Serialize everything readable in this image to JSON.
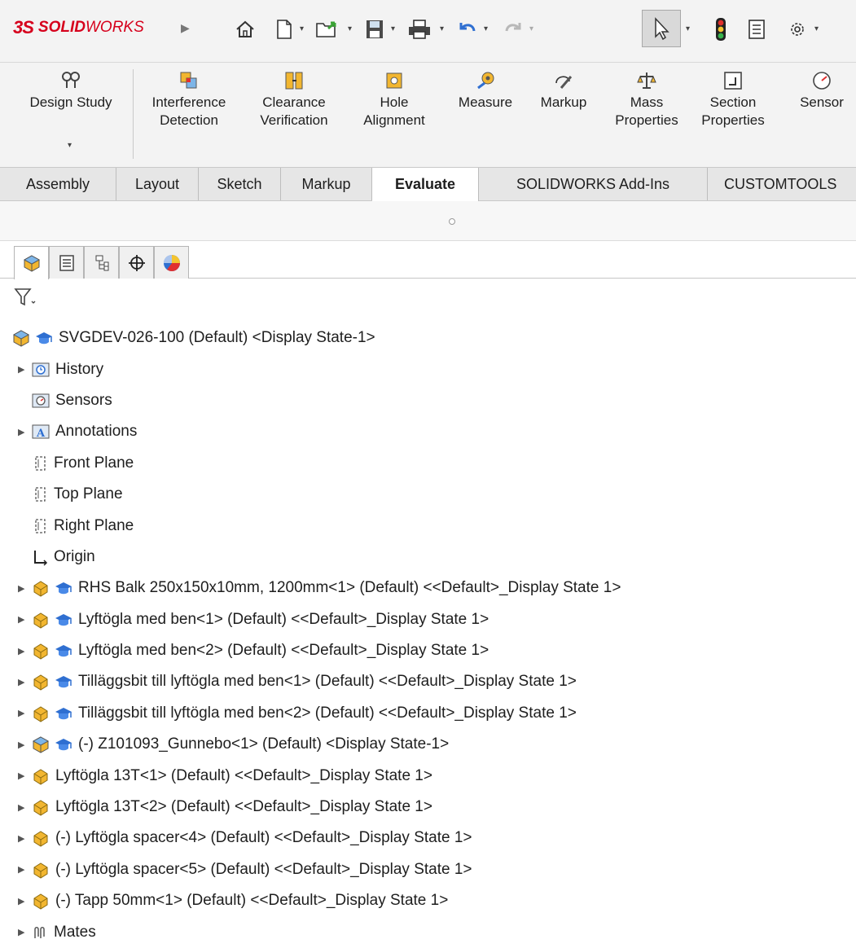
{
  "app": {
    "logo_ds": "3S",
    "logo_solid": "SOLID",
    "logo_works": "WORKS"
  },
  "command_manager": {
    "design_study": "Design Study",
    "interference_1": "Interference",
    "interference_2": "Detection",
    "clearance_1": "Clearance",
    "clearance_2": "Verification",
    "hole_1": "Hole",
    "hole_2": "Alignment",
    "measure": "Measure",
    "markup": "Markup",
    "mass_1": "Mass",
    "mass_2": "Properties",
    "section_1": "Section",
    "section_2": "Properties",
    "sensor": "Sensor"
  },
  "tabs": [
    {
      "label": "Assembly"
    },
    {
      "label": "Layout"
    },
    {
      "label": "Sketch"
    },
    {
      "label": "Markup"
    },
    {
      "label": "Evaluate"
    },
    {
      "label": "SOLIDWORKS Add-Ins"
    },
    {
      "label": "CUSTOMTOOLS"
    }
  ],
  "active_tab": "Evaluate",
  "tree": {
    "root": "SVGDEV-026-100 (Default) <Display State-1>",
    "items": [
      {
        "label": "History"
      },
      {
        "label": "Sensors"
      },
      {
        "label": "Annotations"
      },
      {
        "label": "Front Plane"
      },
      {
        "label": "Top Plane"
      },
      {
        "label": "Right Plane"
      },
      {
        "label": "Origin"
      },
      {
        "label": "RHS Balk 250x150x10mm, 1200mm<1> (Default) <<Default>_Display State 1>"
      },
      {
        "label": "Lyftögla med ben<1> (Default) <<Default>_Display State 1>"
      },
      {
        "label": "Lyftögla med ben<2> (Default) <<Default>_Display State 1>"
      },
      {
        "label": "Tilläggsbit till lyftögla med ben<1> (Default) <<Default>_Display State 1>"
      },
      {
        "label": "Tilläggsbit till lyftögla med ben<2> (Default) <<Default>_Display State 1>"
      },
      {
        "label": "(-) Z101093_Gunnebo<1> (Default) <Display State-1>"
      },
      {
        "label": "Lyftögla 13T<1> (Default) <<Default>_Display State 1>"
      },
      {
        "label": "Lyftögla 13T<2> (Default) <<Default>_Display State 1>"
      },
      {
        "label": "(-) Lyftögla spacer<4> (Default) <<Default>_Display State 1>"
      },
      {
        "label": "(-) Lyftögla spacer<5> (Default) <<Default>_Display State 1>"
      },
      {
        "label": "(-) Tapp 50mm<1> (Default) <<Default>_Display State 1>"
      },
      {
        "label": "Mates"
      }
    ]
  },
  "colors": {
    "brand": "#d6001c",
    "part_yellow": "#f2b630",
    "assembly_blue": "#2f6fd1",
    "toolbar_bg": "#f3f3f3"
  }
}
